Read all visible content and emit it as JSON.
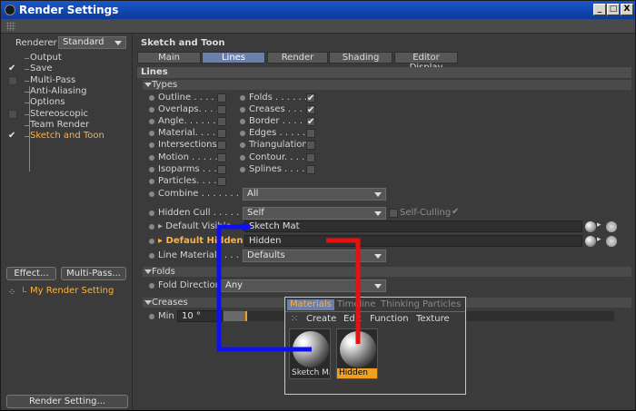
{
  "window": {
    "title": "Render Settings",
    "btn_min": "_",
    "btn_max": "□",
    "btn_close": "X"
  },
  "left": {
    "renderer_label": "Renderer",
    "renderer_value": "Standard",
    "tree": [
      {
        "label": "Output",
        "check": ""
      },
      {
        "label": "Save",
        "check": "✔"
      },
      {
        "label": "Multi-Pass",
        "check": "box"
      },
      {
        "label": "Anti-Aliasing",
        "check": ""
      },
      {
        "label": "Options",
        "check": ""
      },
      {
        "label": "Stereoscopic",
        "check": "box"
      },
      {
        "label": "Team Render",
        "check": ""
      },
      {
        "label": "Sketch and Toon",
        "check": "✔"
      }
    ],
    "effect_btn": "Effect...",
    "multipass_btn": "Multi-Pass...",
    "setting_name": "My Render Setting",
    "render_setting_btn": "Render Setting..."
  },
  "main": {
    "header": "Sketch and Toon",
    "tabs": [
      "Main",
      "Lines",
      "Render",
      "Shading",
      "Editor Display"
    ],
    "active_tab": "Lines",
    "lines_header": "Lines",
    "types_group": "Types",
    "types_left": [
      "Outline . . . . .",
      "Overlaps. . . . .",
      "Angle. . . . . . .",
      "Material. . . . .",
      "Intersections",
      "Motion . . . . . .",
      "Isoparms . . . .",
      "Particles. . . ."
    ],
    "types_left_checked": [
      false,
      false,
      false,
      false,
      false,
      false,
      false,
      false
    ],
    "types_right": [
      "Folds . . . . . . .",
      "Creases . . . . .",
      "Border . . . . . .",
      "Edges . . . . . .",
      "Triangulation",
      "Contour. . . . . .",
      "Splines . . . . ."
    ],
    "types_right_checked": [
      true,
      true,
      true,
      false,
      false,
      false,
      false
    ],
    "check_glyph": "✔",
    "combine_label": "Combine . . . . . . . . . .",
    "combine_value": "All",
    "hidden_cull_label": "Hidden Cull . . . . . . .",
    "hidden_cull_value": "Self",
    "self_culling_label": "Self-Culling",
    "default_visible_label": "Default Visible",
    "default_visible_value": "Sketch Mat",
    "default_hidden_label": "Default Hidden",
    "default_hidden_value": "Hidden",
    "line_materials_label": "Line Materials . . . . .",
    "line_materials_value": "Defaults",
    "folds_group": "Folds",
    "fold_direction_label": "Fold Direction",
    "fold_direction_value": "Any",
    "creases_group": "Creases",
    "min_label": "Min",
    "min_value": "10 °"
  },
  "popup": {
    "tabs": [
      "Materials",
      "Timeline",
      "Thinking Particles"
    ],
    "menu": [
      "Create",
      "Edit",
      "Function",
      "Texture"
    ],
    "materials": [
      {
        "name": "Sketch Mat",
        "selected": false
      },
      {
        "name": "Hidden",
        "selected": true
      }
    ]
  },
  "colors": {
    "accent": "#ffb23e",
    "tab_active": "#6d7ea8",
    "blue_arrow": "#1010ee",
    "red_arrow": "#e81010"
  }
}
